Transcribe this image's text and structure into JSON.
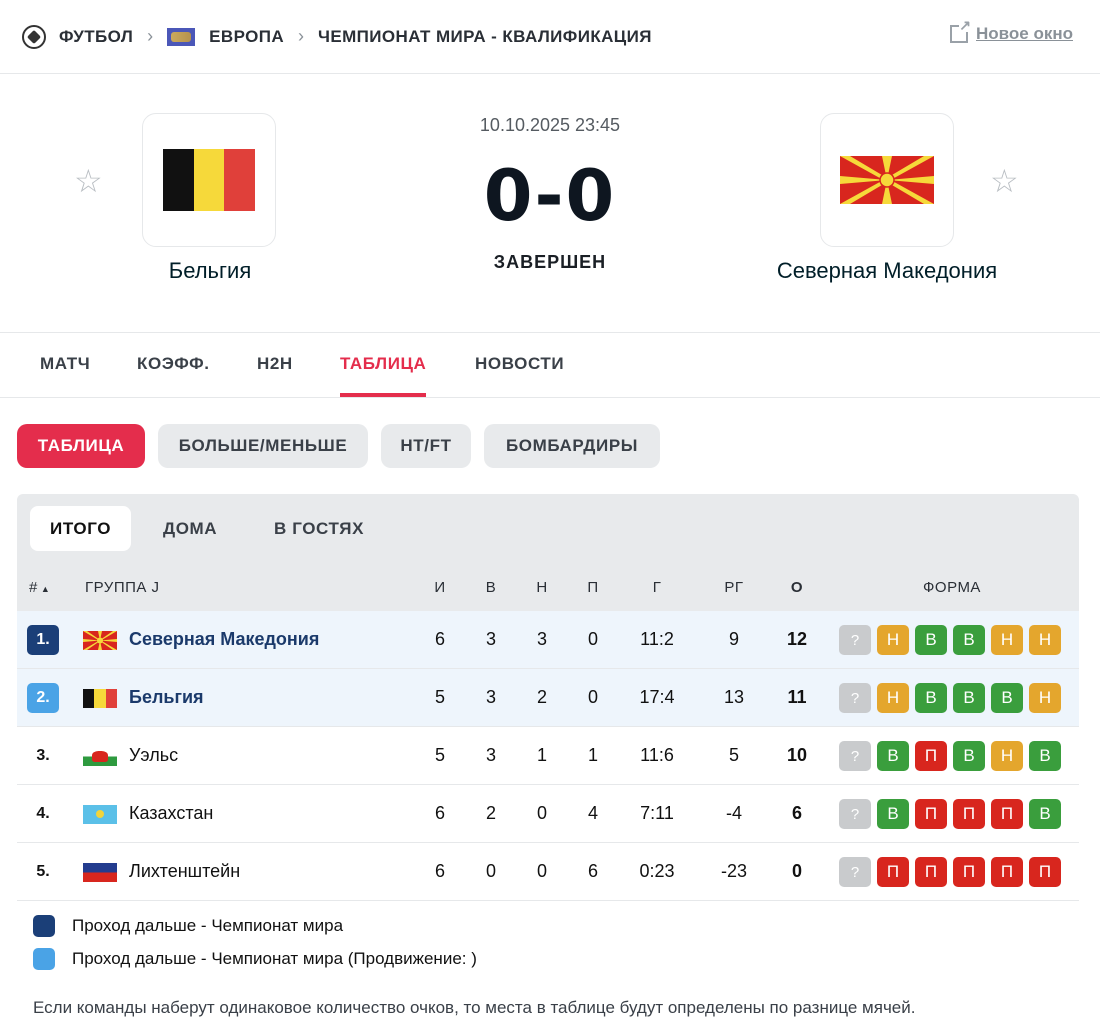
{
  "breadcrumb": {
    "sport": "ФУТБОЛ",
    "region": "ЕВРОПА",
    "competition": "ЧЕМПИОНАТ МИРА - КВАЛИФИКАЦИЯ",
    "new_window": "Новое окно"
  },
  "match": {
    "date": "10.10.2025 23:45",
    "score": "0-0",
    "status": "ЗАВЕРШЕН",
    "home": "Бельгия",
    "away": "Северная Македония"
  },
  "tabs": [
    "МАТЧ",
    "КОЭФФ.",
    "H2H",
    "ТАБЛИЦА",
    "НОВОСТИ"
  ],
  "pills": [
    "ТАБЛИЦА",
    "БОЛЬШЕ/МЕНЬШЕ",
    "HT/FT",
    "БОМБАРДИРЫ"
  ],
  "subtabs": [
    "ИТОГО",
    "ДОМА",
    "В ГОСТЯХ"
  ],
  "table": {
    "headers": {
      "rank": "#",
      "group": "ГРУППА J",
      "played": "И",
      "won": "В",
      "drawn": "Н",
      "lost": "П",
      "goals": "Г",
      "diff": "РГ",
      "points": "О",
      "form": "ФОРМА"
    },
    "rows": [
      {
        "rank": "1.",
        "team": "Северная Македония",
        "p": "6",
        "w": "3",
        "d": "3",
        "l": "0",
        "g": "11:2",
        "gd": "9",
        "pts": "12",
        "form": [
          "?",
          "Н",
          "В",
          "В",
          "Н",
          "Н"
        ]
      },
      {
        "rank": "2.",
        "team": "Бельгия",
        "p": "5",
        "w": "3",
        "d": "2",
        "l": "0",
        "g": "17:4",
        "gd": "13",
        "pts": "11",
        "form": [
          "?",
          "Н",
          "В",
          "В",
          "В",
          "Н"
        ]
      },
      {
        "rank": "3.",
        "team": "Уэльс",
        "p": "5",
        "w": "3",
        "d": "1",
        "l": "1",
        "g": "11:6",
        "gd": "5",
        "pts": "10",
        "form": [
          "?",
          "В",
          "П",
          "В",
          "Н",
          "В"
        ]
      },
      {
        "rank": "4.",
        "team": "Казахстан",
        "p": "6",
        "w": "2",
        "d": "0",
        "l": "4",
        "g": "7:11",
        "gd": "-4",
        "pts": "6",
        "form": [
          "?",
          "В",
          "П",
          "П",
          "П",
          "В"
        ]
      },
      {
        "rank": "5.",
        "team": "Лихтенштейн",
        "p": "6",
        "w": "0",
        "d": "0",
        "l": "6",
        "g": "0:23",
        "gd": "-23",
        "pts": "0",
        "form": [
          "?",
          "П",
          "П",
          "П",
          "П",
          "П"
        ]
      }
    ]
  },
  "legend": [
    {
      "label": "Проход дальше - Чемпионат мира",
      "color": "#1b3f78"
    },
    {
      "label": "Проход дальше - Чемпионат мира (Продвижение: )",
      "color": "#4aa3e6"
    }
  ],
  "note": "Если команды наберут одинаковое количество очков, то места в таблице будут определены по разнице мячей."
}
